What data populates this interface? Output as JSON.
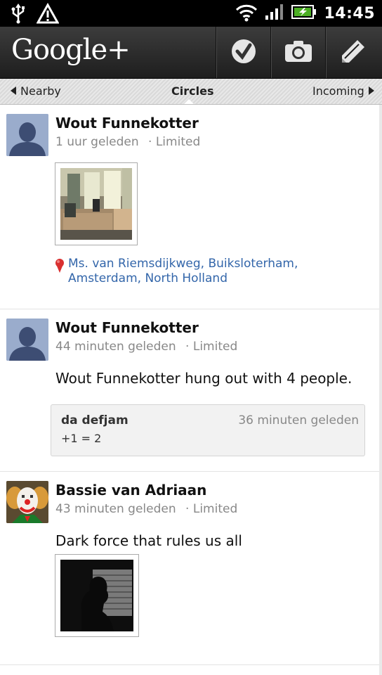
{
  "status_bar": {
    "time": "14:45"
  },
  "header": {
    "logo": "Google+"
  },
  "tabs": {
    "left": "Nearby",
    "center": "Circles",
    "right": "Incoming"
  },
  "posts": [
    {
      "author": "Wout Funnekotter",
      "time": "1 uur geleden",
      "visibility": "· Limited",
      "location": "Ms. van Riemsdijkweg, Buiksloterham, Amsterdam, North Holland"
    },
    {
      "author": "Wout Funnekotter",
      "time": "44 minuten geleden",
      "visibility": "· Limited",
      "text": "Wout Funnekotter hung out with 4 people.",
      "comment": {
        "author": "da defjam",
        "time": "36 minuten geleden",
        "text": "+1 = 2"
      }
    },
    {
      "author": "Bassie van Adriaan",
      "time": "43 minuten geleden",
      "visibility": "· Limited",
      "text": "Dark force that rules us all"
    }
  ],
  "colors": {
    "link": "#3366aa",
    "pin": "#d93030",
    "battery": "#4caf24"
  }
}
